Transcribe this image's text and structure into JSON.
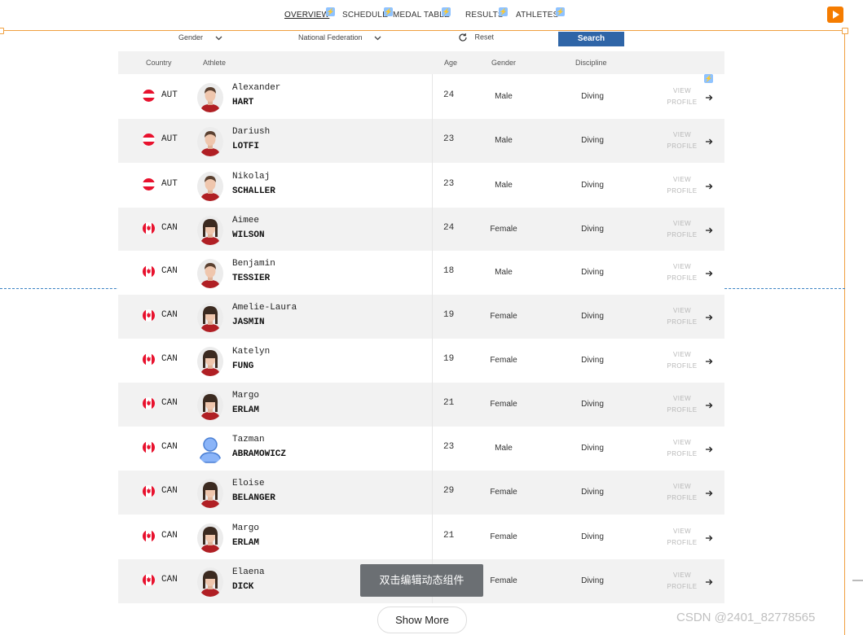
{
  "nav": {
    "items": [
      {
        "label": "OVERVIEW",
        "active": true
      },
      {
        "label": "SCHEDULE",
        "active": false
      },
      {
        "label": "MEDAL TABLE",
        "active": false
      },
      {
        "label": "RESULTS",
        "active": false
      },
      {
        "label": "ATHLETES",
        "active": false
      }
    ],
    "play_icon": "play-icon",
    "bolt_icon": "lightning-icon"
  },
  "filters": {
    "gender_label": "Gender",
    "federation_label": "National Federation",
    "reset_label": "Reset",
    "search_label": "Search",
    "accent_color": "#2f65a7"
  },
  "table": {
    "headers": {
      "country": "Country",
      "athlete": "Athlete",
      "age": "Age",
      "gender": "Gender",
      "discipline": "Discipline"
    },
    "view_label_1": "VIEW",
    "view_label_2": "PROFILE",
    "rows": [
      {
        "code": "AUT",
        "first": "Alexander",
        "last": "HART",
        "age": "24",
        "gender": "Male",
        "discipline": "Diving",
        "flag": "austria",
        "photo": "male"
      },
      {
        "code": "AUT",
        "first": "Dariush",
        "last": "LOTFI",
        "age": "23",
        "gender": "Male",
        "discipline": "Diving",
        "flag": "austria",
        "photo": "male"
      },
      {
        "code": "AUT",
        "first": "Nikolaj",
        "last": "SCHALLER",
        "age": "23",
        "gender": "Male",
        "discipline": "Diving",
        "flag": "austria",
        "photo": "male"
      },
      {
        "code": "CAN",
        "first": "Aimee",
        "last": "WILSON",
        "age": "24",
        "gender": "Female",
        "discipline": "Diving",
        "flag": "canada",
        "photo": "female"
      },
      {
        "code": "CAN",
        "first": "Benjamin",
        "last": "TESSIER",
        "age": "18",
        "gender": "Male",
        "discipline": "Diving",
        "flag": "canada",
        "photo": "male"
      },
      {
        "code": "CAN",
        "first": "Amelie-Laura",
        "last": "JASMIN",
        "age": "19",
        "gender": "Female",
        "discipline": "Diving",
        "flag": "canada",
        "photo": "female"
      },
      {
        "code": "CAN",
        "first": "Katelyn",
        "last": "FUNG",
        "age": "19",
        "gender": "Female",
        "discipline": "Diving",
        "flag": "canada",
        "photo": "female"
      },
      {
        "code": "CAN",
        "first": "Margo",
        "last": "ERLAM",
        "age": "21",
        "gender": "Female",
        "discipline": "Diving",
        "flag": "canada",
        "photo": "female"
      },
      {
        "code": "CAN",
        "first": "Tazman",
        "last": "ABRAMOWICZ",
        "age": "23",
        "gender": "Male",
        "discipline": "Diving",
        "flag": "canada",
        "photo": "placeholder"
      },
      {
        "code": "CAN",
        "first": "Eloise",
        "last": "BELANGER",
        "age": "29",
        "gender": "Female",
        "discipline": "Diving",
        "flag": "canada",
        "photo": "female"
      },
      {
        "code": "CAN",
        "first": "Margo",
        "last": "ERLAM",
        "age": "21",
        "gender": "Female",
        "discipline": "Diving",
        "flag": "canada",
        "photo": "female"
      },
      {
        "code": "CAN",
        "first": "Elaena",
        "last": "DICK",
        "age": "",
        "gender": "Female",
        "discipline": "Diving",
        "flag": "canada",
        "photo": "female"
      }
    ]
  },
  "tooltip": "双击编辑动态组件",
  "show_more_label": "Show More",
  "watermark": "CSDN @2401_82778565"
}
